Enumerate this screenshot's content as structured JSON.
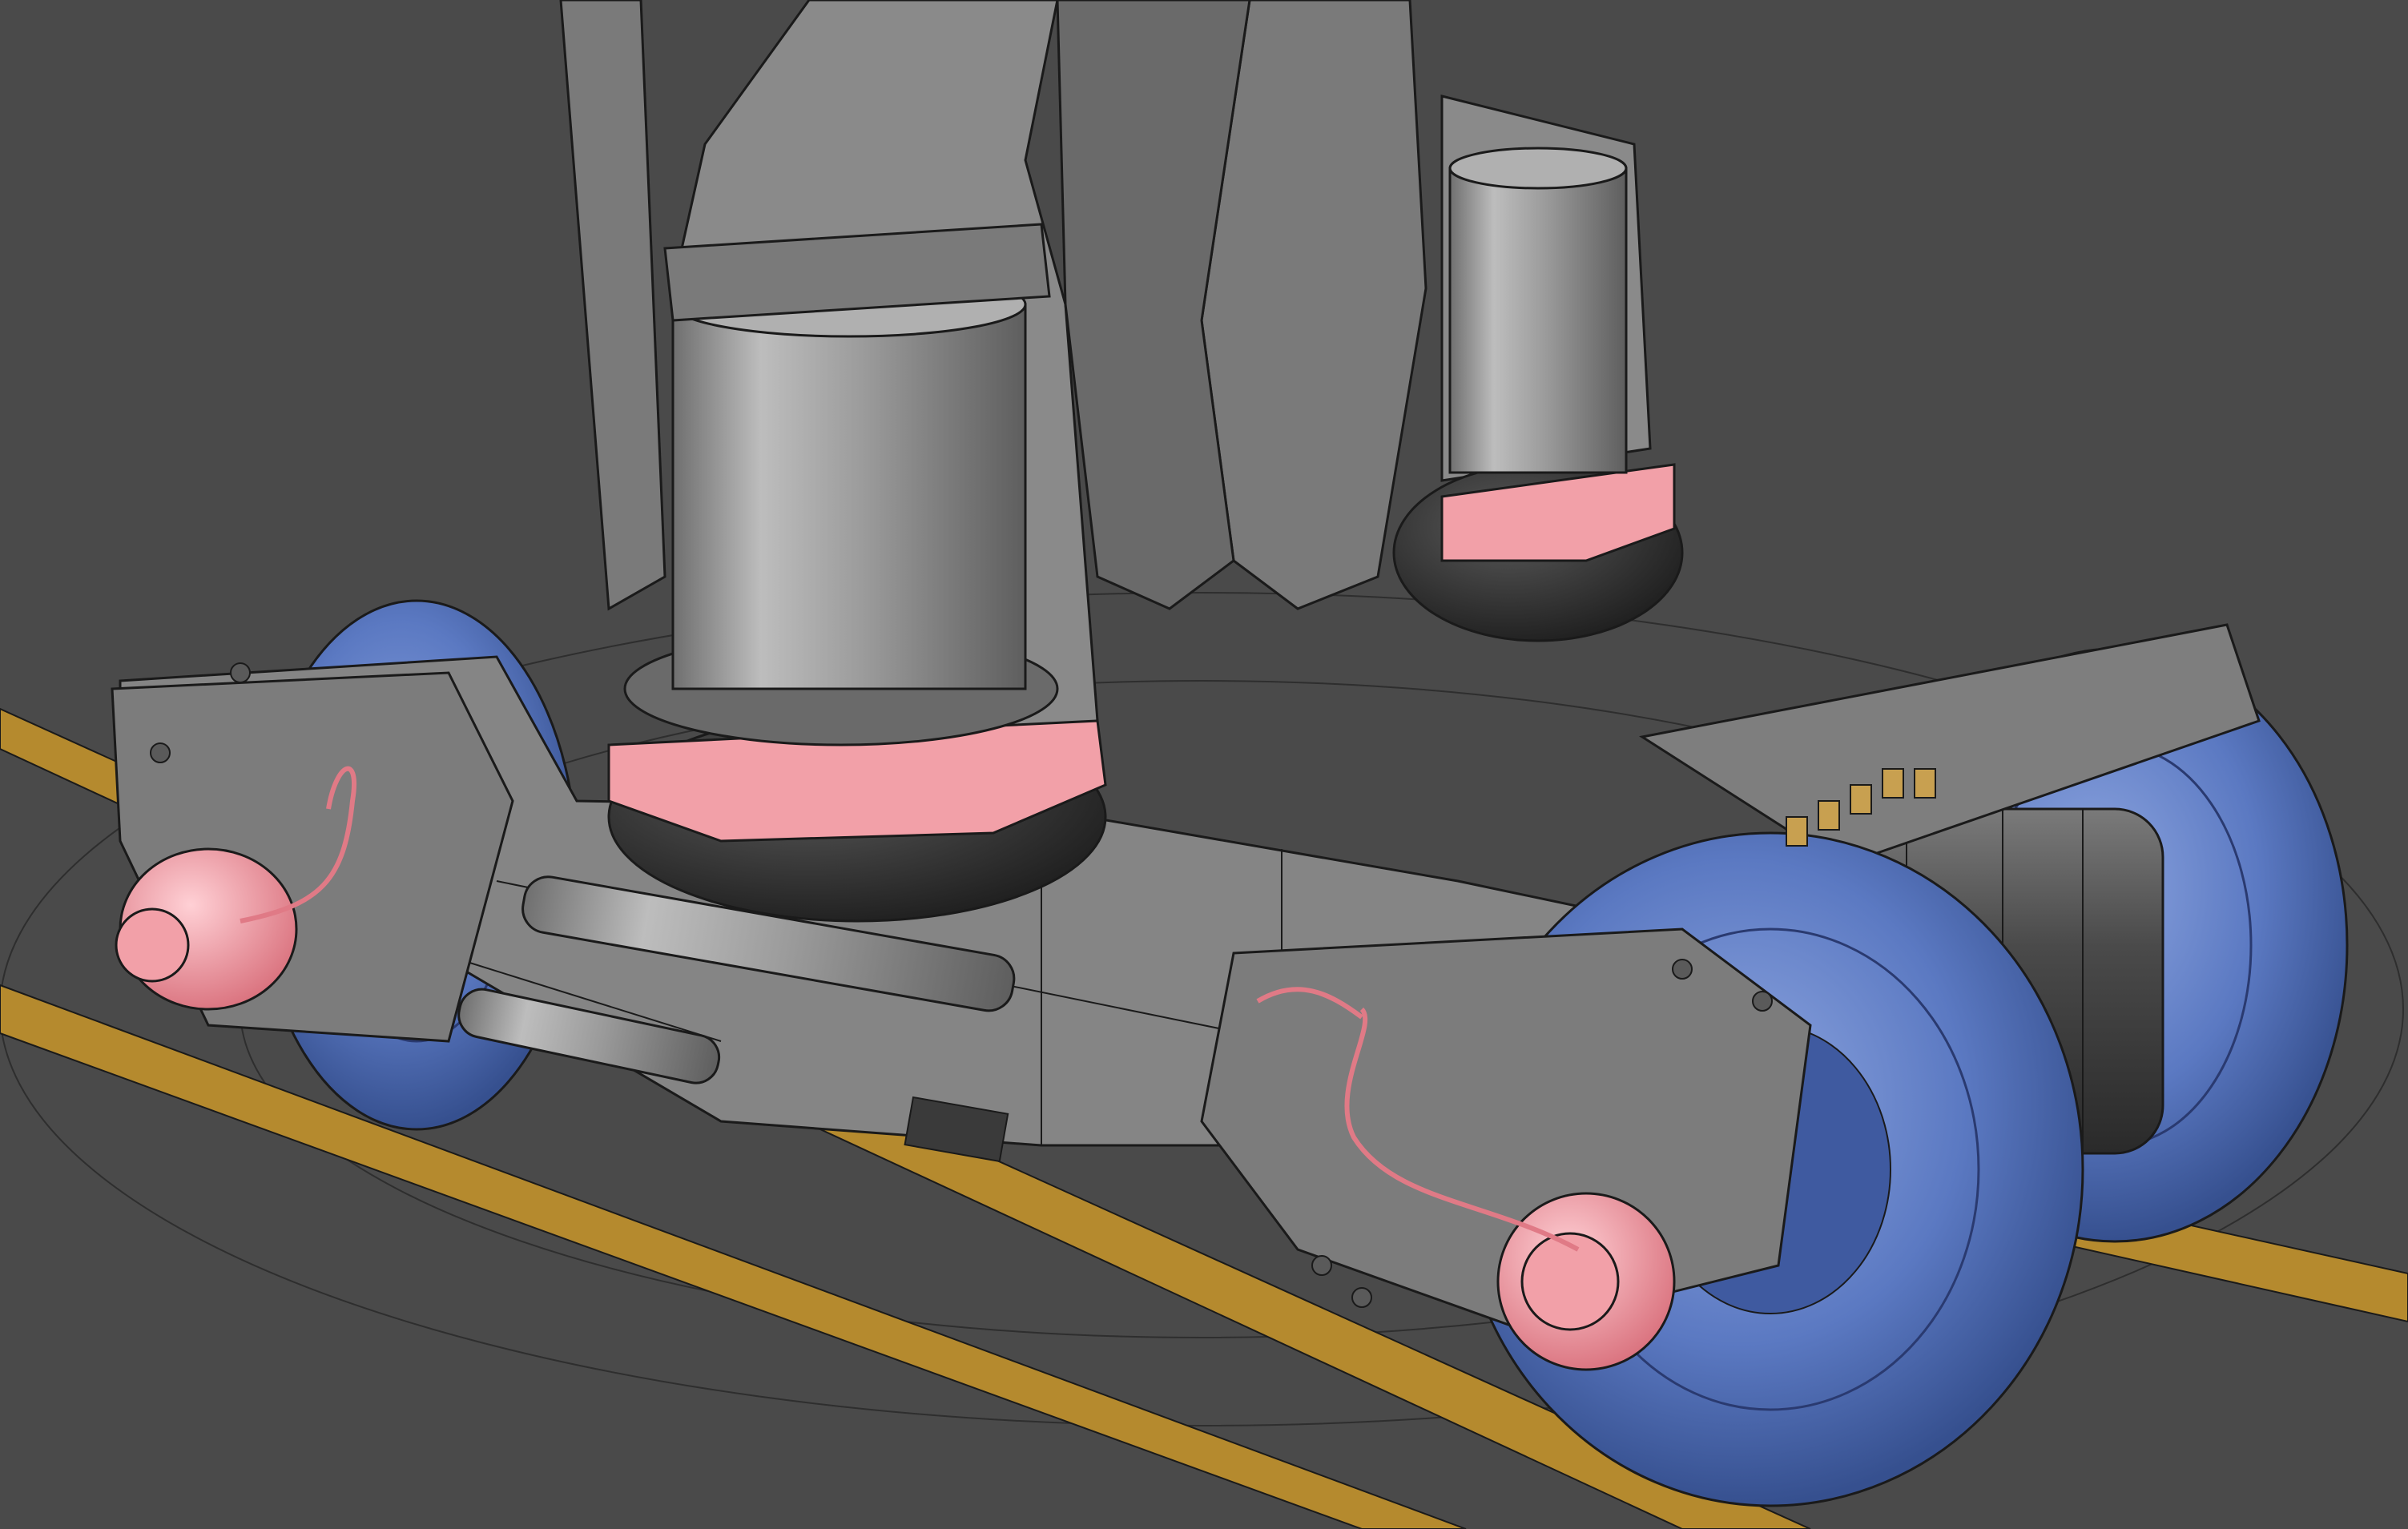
{
  "viewport": {
    "background_color": "#4a4a4a",
    "grid_line_color": "#2e2e2e",
    "rail_color": "#b58a2e"
  },
  "model": {
    "frame_color": "#8a8a8a",
    "frame_shade_color": "#6a6a6a",
    "wireframe_color": "#1a1a1a",
    "air_spring_color": "#9c9c9c",
    "bellow_color": "#3a3a3a",
    "highlight_color": "#f2a0a8",
    "wheel_color": "#5b79c2",
    "wheel_shade_color": "#3f5aa0",
    "axle_color": "#5a5a5a",
    "brass_color": "#c8a050"
  },
  "nameplate": {
    "line1": "",
    "line2": ""
  }
}
